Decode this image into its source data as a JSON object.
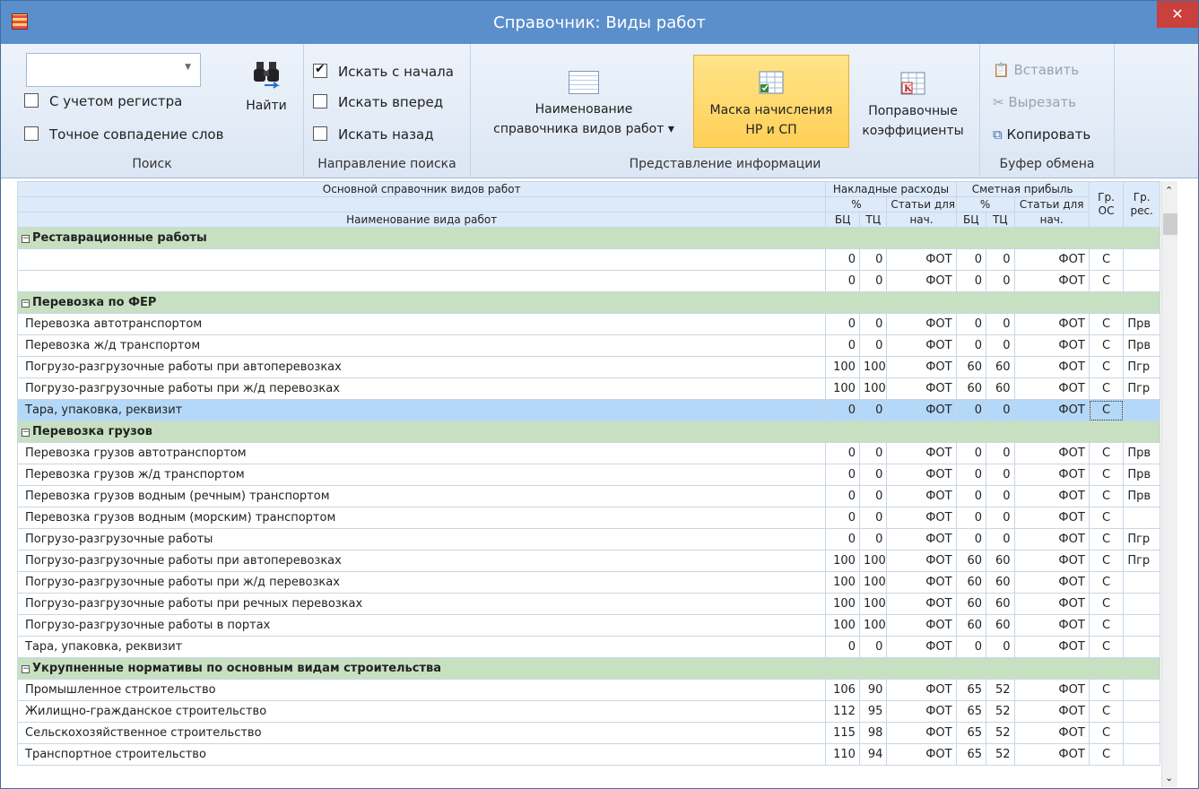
{
  "window": {
    "title": "Справочник: Виды работ",
    "close": "✕"
  },
  "ribbon": {
    "search": {
      "combo_value": "",
      "find_label": "Найти",
      "case_label": "С учетом регистра",
      "exact_label": "Точное совпадение слов",
      "group": "Поиск"
    },
    "direction": {
      "from_start": "Искать с начала",
      "forward": "Искать вперед",
      "backward": "Искать назад",
      "from_start_checked": true,
      "group": "Направление поиска"
    },
    "view": {
      "name_line1": "Наименование",
      "name_line2": "справочника видов работ ▾",
      "mask_line1": "Маска начисления",
      "mask_line2": "НР и СП",
      "coef_line1": "Поправочные",
      "coef_line2": "коэффициенты",
      "group": "Представление информации"
    },
    "clipboard": {
      "paste": "Вставить",
      "cut": "Вырезать",
      "copy": "Копировать",
      "group": "Буфер обмена"
    }
  },
  "grid": {
    "headers": {
      "main": "Основной справочник видов работ",
      "nr": "Накладные расходы",
      "sp": "Сметная прибыль",
      "gr_os_1": "Гр.",
      "gr_os_2": "ОС",
      "gr_res_1": "Гр.",
      "gr_res_2": "рес.",
      "pct": "%",
      "stat1": "Статьи для",
      "stat2": "нач.",
      "name": "Наименование вида работ",
      "bc": "БЦ",
      "tc": "ТЦ"
    },
    "groups": [
      {
        "title": "Реставрационные работы",
        "rows": [
          [
            "",
            "0",
            "0",
            "ФОТ",
            "0",
            "0",
            "ФОТ",
            "С",
            ""
          ],
          [
            "",
            "0",
            "0",
            "ФОТ",
            "0",
            "0",
            "ФОТ",
            "С",
            ""
          ]
        ]
      },
      {
        "title": "Перевозка по ФЕР",
        "rows": [
          [
            "Перевозка автотранспортом",
            "0",
            "0",
            "ФОТ",
            "0",
            "0",
            "ФОТ",
            "С",
            "Прв"
          ],
          [
            "Перевозка ж/д транспортом",
            "0",
            "0",
            "ФОТ",
            "0",
            "0",
            "ФОТ",
            "С",
            "Прв"
          ],
          [
            "Погрузо-разгрузочные работы при автоперевозках",
            "100",
            "100",
            "ФОТ",
            "60",
            "60",
            "ФОТ",
            "С",
            "Пгр"
          ],
          [
            "Погрузо-разгрузочные работы при ж/д перевозках",
            "100",
            "100",
            "ФОТ",
            "60",
            "60",
            "ФОТ",
            "С",
            "Пгр"
          ],
          [
            "Тара, упаковка, реквизит",
            "0",
            "0",
            "ФОТ",
            "0",
            "0",
            "ФОТ",
            "С",
            ""
          ]
        ]
      },
      {
        "title": "Перевозка грузов",
        "rows": [
          [
            "Перевозка грузов автотранспортом",
            "0",
            "0",
            "ФОТ",
            "0",
            "0",
            "ФОТ",
            "С",
            "Прв"
          ],
          [
            "Перевозка грузов ж/д транспортом",
            "0",
            "0",
            "ФОТ",
            "0",
            "0",
            "ФОТ",
            "С",
            "Прв"
          ],
          [
            "Перевозка грузов водным (речным) транспортом",
            "0",
            "0",
            "ФОТ",
            "0",
            "0",
            "ФОТ",
            "С",
            "Прв"
          ],
          [
            "Перевозка грузов водным (морским) транспортом",
            "0",
            "0",
            "ФОТ",
            "0",
            "0",
            "ФОТ",
            "С",
            ""
          ],
          [
            "Погрузо-разгрузочные работы",
            "0",
            "0",
            "ФОТ",
            "0",
            "0",
            "ФОТ",
            "С",
            "Пгр"
          ],
          [
            "Погрузо-разгрузочные работы при автоперевозках",
            "100",
            "100",
            "ФОТ",
            "60",
            "60",
            "ФОТ",
            "С",
            "Пгр"
          ],
          [
            "Погрузо-разгрузочные работы при ж/д перевозках",
            "100",
            "100",
            "ФОТ",
            "60",
            "60",
            "ФОТ",
            "С",
            ""
          ],
          [
            "Погрузо-разгрузочные работы при речных перевозках",
            "100",
            "100",
            "ФОТ",
            "60",
            "60",
            "ФОТ",
            "С",
            ""
          ],
          [
            "Погрузо-разгрузочные работы в портах",
            "100",
            "100",
            "ФОТ",
            "60",
            "60",
            "ФОТ",
            "С",
            ""
          ],
          [
            "Тара, упаковка, реквизит",
            "0",
            "0",
            "ФОТ",
            "0",
            "0",
            "ФОТ",
            "С",
            ""
          ]
        ]
      },
      {
        "title": "Укрупненные нормативы по основным видам строительства",
        "rows": [
          [
            "Промышленное строительство",
            "106",
            "90",
            "ФОТ",
            "65",
            "52",
            "ФОТ",
            "С",
            ""
          ],
          [
            "Жилищно-гражданское строительство",
            "112",
            "95",
            "ФОТ",
            "65",
            "52",
            "ФОТ",
            "С",
            ""
          ],
          [
            "Сельскохозяйственное строительство",
            "115",
            "98",
            "ФОТ",
            "65",
            "52",
            "ФОТ",
            "С",
            ""
          ],
          [
            "Транспортное строительство",
            "110",
            "94",
            "ФОТ",
            "65",
            "52",
            "ФОТ",
            "С",
            ""
          ]
        ]
      }
    ],
    "selected_group": 1,
    "selected_row": 4
  },
  "colors": {
    "titlebar": "#5b8fcb",
    "close": "#c9403d",
    "group_row": "#c7e0c1",
    "selected_row": "#b4d8f7",
    "header": "#ddeaf9"
  }
}
